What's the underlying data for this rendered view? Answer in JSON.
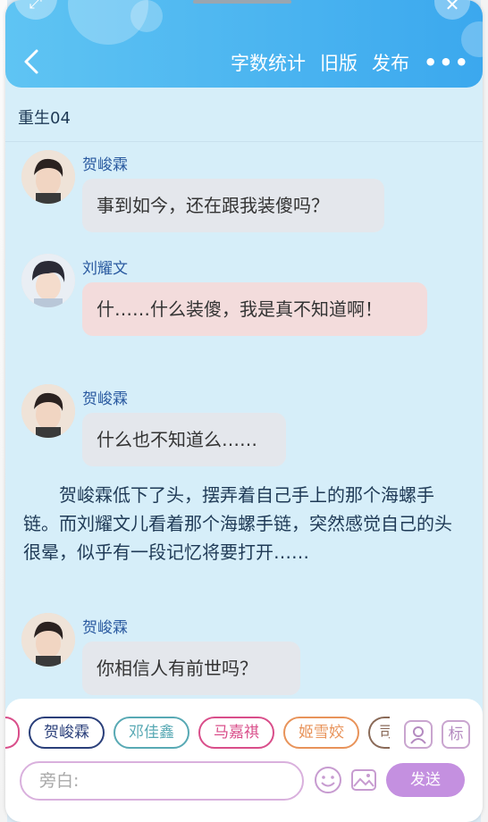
{
  "header": {
    "back_icon": "chevron-left-icon",
    "actions": [
      "字数统计",
      "旧版",
      "发布"
    ],
    "more": "•••",
    "expand_icon": "expand-icon",
    "close_icon": "close-icon"
  },
  "chapter_title": "重生04",
  "messages": [
    {
      "speaker": "贺峻霖",
      "text": "事到如今，还在跟我装傻吗？",
      "style": "gray"
    },
    {
      "speaker": "刘耀文",
      "text": "什……什么装傻，我是真不知道啊！",
      "style": "pink"
    },
    {
      "speaker": "贺峻霖",
      "text": "什么也不知道么……",
      "style": "gray"
    }
  ],
  "narration": "贺峻霖低下了头，摆弄着自己手上的那个海螺手链。而刘耀文儿看着那个海螺手链，突然感觉自己的头很晕，似乎有一段记忆将要打开……",
  "last_message": {
    "speaker": "贺峻霖",
    "text": "你相信人有前世吗？",
    "style": "gray"
  },
  "character_chips": [
    {
      "label": "贺峻霖",
      "color": "#2a3f7a"
    },
    {
      "label": "邓佳鑫",
      "color": "#58a9b4"
    },
    {
      "label": "马嘉祺",
      "color": "#d94e8a"
    },
    {
      "label": "姬雪姣",
      "color": "#e8935a"
    },
    {
      "label": "司",
      "color": "#8a6a58"
    }
  ],
  "side_buttons": {
    "person_icon": "person-card-icon",
    "tag_label": "标"
  },
  "input": {
    "placeholder": "旁白:"
  },
  "emoji_icon": "smiley-icon",
  "image_icon": "image-icon",
  "send_label": "发送",
  "colors": {
    "header": "#3ba8ee",
    "background": "#d6eef9",
    "send": "#c490e0"
  }
}
